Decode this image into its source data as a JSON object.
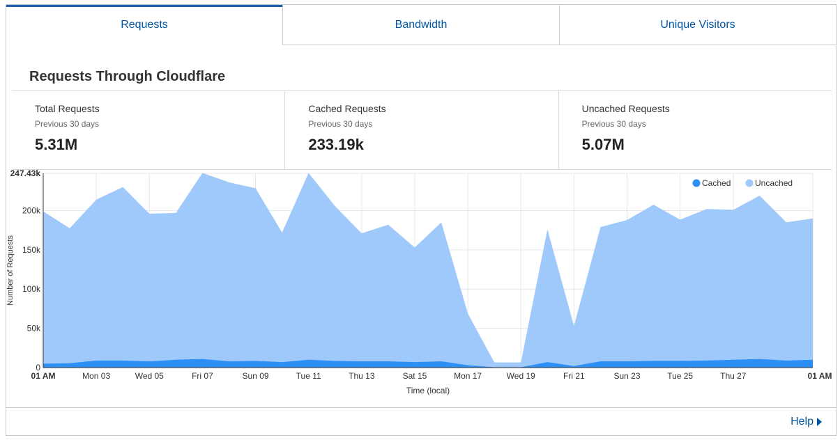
{
  "tabs": [
    {
      "label": "Requests",
      "active": true
    },
    {
      "label": "Bandwidth",
      "active": false
    },
    {
      "label": "Unique Visitors",
      "active": false
    }
  ],
  "section_title": "Requests Through Cloudflare",
  "stats": [
    {
      "label": "Total Requests",
      "period": "Previous 30 days",
      "value": "5.31M"
    },
    {
      "label": "Cached Requests",
      "period": "Previous 30 days",
      "value": "233.19k"
    },
    {
      "label": "Uncached Requests",
      "period": "Previous 30 days",
      "value": "5.07M"
    }
  ],
  "help_label": "Help",
  "colors": {
    "cached": "#2c8ff5",
    "uncached": "#9fc9fa",
    "link": "#0055a4",
    "grid": "#e6e6e6"
  },
  "chart_data": {
    "type": "area",
    "stacked": true,
    "xlabel": "Time (local)",
    "ylabel": "Number of Requests",
    "ylim": [
      0,
      247430
    ],
    "y_ticks": [
      0,
      50000,
      100000,
      150000,
      200000,
      247430
    ],
    "y_tick_labels": [
      "0",
      "50k",
      "100k",
      "150k",
      "200k",
      "247.43k"
    ],
    "x_tick_labels": [
      "01 AM",
      "Mon 03",
      "Wed 05",
      "Fri 07",
      "Sun 09",
      "Tue 11",
      "Thu 13",
      "Sat 15",
      "Mon 17",
      "Wed 19",
      "Fri 21",
      "Sun 23",
      "Tue 25",
      "Thu 27",
      "01 AM"
    ],
    "x": [
      0,
      1,
      2,
      3,
      4,
      5,
      6,
      7,
      8,
      9,
      10,
      11,
      12,
      13,
      14,
      15,
      16,
      17,
      18,
      19,
      20,
      21,
      22,
      23,
      24,
      25,
      26,
      27,
      28,
      29
    ],
    "legend": {
      "position": "top-right"
    },
    "series": [
      {
        "name": "Cached",
        "color": "#2c8ff5",
        "values": [
          5000,
          5500,
          9000,
          9000,
          8000,
          10000,
          11000,
          8000,
          8500,
          7000,
          10000,
          8500,
          8000,
          8000,
          7000,
          8000,
          3000,
          500,
          500,
          7000,
          2000,
          8000,
          8000,
          8500,
          8500,
          9000,
          10000,
          11000,
          9000,
          10000
        ]
      },
      {
        "name": "Uncached",
        "color": "#9fc9fa",
        "values": [
          194000,
          172000,
          205000,
          221000,
          188000,
          187000,
          237000,
          228000,
          220000,
          165000,
          238000,
          197000,
          163000,
          174000,
          146000,
          177000,
          66000,
          6000,
          6000,
          169000,
          51000,
          171000,
          180000,
          199000,
          180000,
          193000,
          191000,
          208000,
          176000,
          180000
        ]
      }
    ]
  }
}
